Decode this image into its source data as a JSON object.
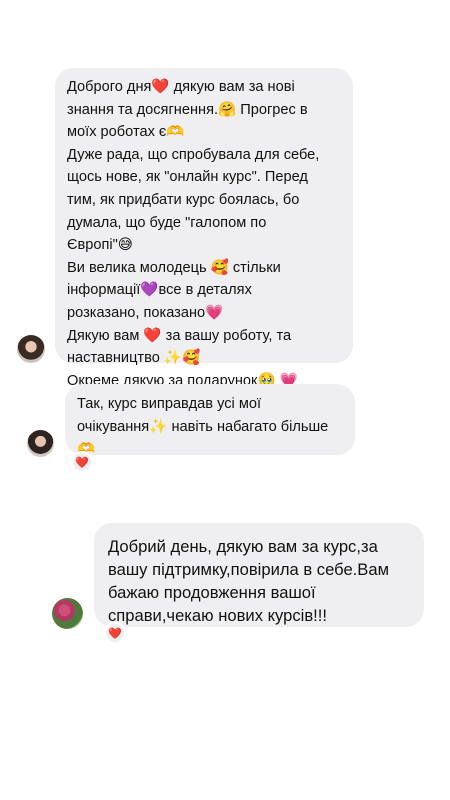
{
  "thread": {
    "messages": [
      {
        "lines": [
          "Доброго дня❤️ дякую вам за нові",
          "знання та досягнення.🤗 Прогрес в",
          "моїх роботах є🫶",
          "Дуже рада, що спробувала для себе,",
          "щось нове, як \"онлайн курс\". Перед",
          "тим, як придбати курс боялась, бо",
          "думала, що буде \"галопом по",
          "Європі\"😅",
          " Ви велика молодець 🥰 стільки",
          "інформації💜все в деталях",
          "розказано, показано💗",
          "Дякую вам ❤️ за вашу роботу, та",
          "наставництво ✨🥰",
          "Окреме дякую за подарунок🥹 💗"
        ]
      },
      {
        "lines": [
          "Так, курс виправдав усі мої",
          "очікування✨ навіть набагато більше",
          "🫶"
        ],
        "reaction": "❤️"
      },
      {
        "lines": [
          "Добрий день, дякую вам за курс,за",
          "вашу підтримку,повірила в себе.Вам",
          "бажаю продовження вашої",
          "справи,чекаю нових курсів!!!"
        ],
        "reaction": "❤️"
      }
    ]
  }
}
